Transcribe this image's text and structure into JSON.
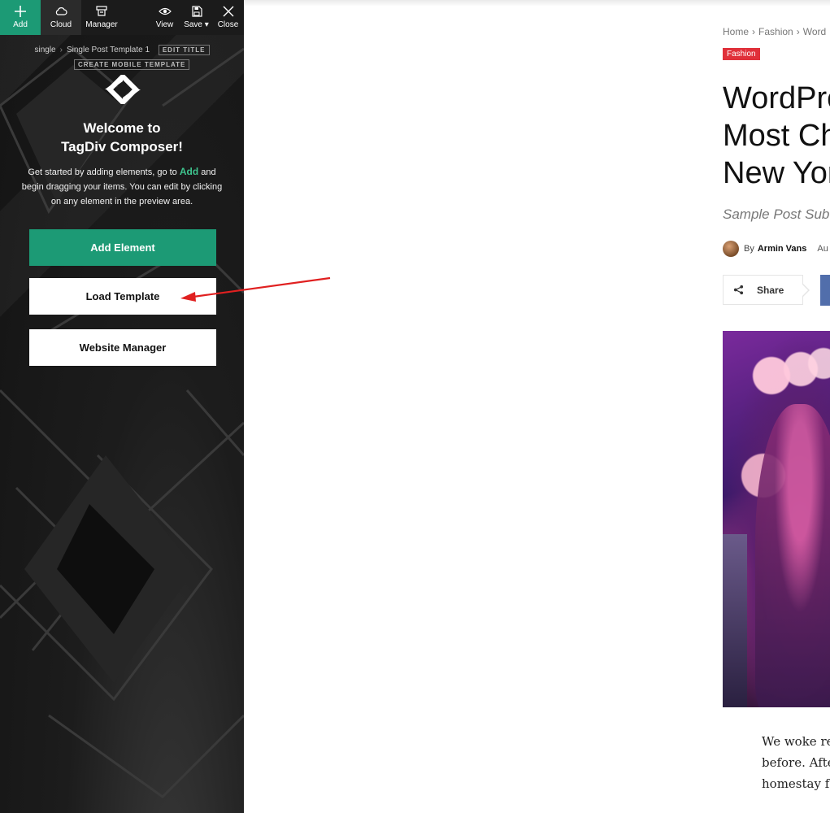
{
  "toolbar": {
    "add_label": "Add",
    "cloud_label": "Cloud",
    "manager_label": "Manager",
    "view_label": "View",
    "save_label": "Save",
    "close_label": "Close"
  },
  "breadcrumb": {
    "part1": "single",
    "part2": "Single Post Template 1",
    "edit_title_label": "EDIT TITLE",
    "mobile_template_label": "CREATE MOBILE TEMPLATE"
  },
  "welcome": {
    "line1": "Welcome to",
    "line2": "TagDiv Composer!",
    "intro_before": "Get started by adding elements, go to ",
    "intro_highlight": "Add",
    "intro_after": " and begin dragging your items. You can edit by clicking on any element in the preview area."
  },
  "buttons": {
    "add_element": "Add Element",
    "load_template": "Load Template",
    "website_manager": "Website Manager"
  },
  "preview": {
    "breadcrumbs": [
      "Home",
      "Fashion",
      "Word"
    ],
    "category": "Fashion",
    "title_lines": [
      "WordPre",
      "Most Ch",
      "New Yor"
    ],
    "subtitle": "Sample Post Sub",
    "author_by": "By",
    "author_name": "Armin Vans",
    "date_fragment": "Au",
    "share_label": "Share",
    "body_lines": [
      "We woke re",
      "before. Afte",
      "homestay f"
    ]
  },
  "colors": {
    "accent_green": "#1c9a75",
    "category_red": "#e0303a",
    "facebook_blue": "#516eab",
    "annotation_arrow": "#e02020"
  },
  "icons": [
    "plus-icon",
    "cloud-icon",
    "manager-icon",
    "eye-icon",
    "save-icon",
    "close-icon",
    "tagdiv-logo-icon",
    "share-icon"
  ]
}
